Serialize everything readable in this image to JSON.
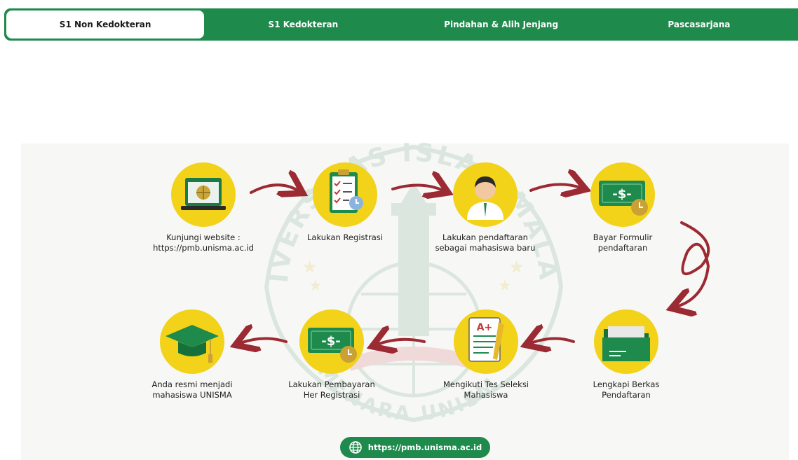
{
  "tabs": [
    {
      "label": "S1 Non Kedokteran",
      "active": true
    },
    {
      "label": "S1 Kedokteran",
      "active": false
    },
    {
      "label": "Pindahan & Alih Jenjang",
      "active": false
    },
    {
      "label": "Pascasarjana",
      "active": false
    }
  ],
  "watermark": {
    "text": "UNIVERSITAS ISLAM MALANG",
    "motto": "MENARA UNISMA"
  },
  "steps": [
    {
      "label": "Kunjungi website :\nhttps://pmb.unisma.ac.id",
      "icon": "globe-laptop-icon"
    },
    {
      "label": "Lakukan Registrasi",
      "icon": "clipboard-checklist-icon"
    },
    {
      "label": "Lakukan pendaftaran\nsebagai mahasiswa baru",
      "icon": "student-avatar-icon"
    },
    {
      "label": "Bayar Formulir\npendaftaran",
      "icon": "money-bill-clock-icon"
    },
    {
      "label": "Lengkapi Berkas\nPendaftaran",
      "icon": "folder-icon"
    },
    {
      "label": "Mengikuti Tes Seleksi\nMahasiswa",
      "icon": "exam-paper-icon"
    },
    {
      "label": "Lakukan Pembayaran\nHer Registrasi",
      "icon": "money-bill-clock-icon"
    },
    {
      "label": "Anda resmi menjadi\nmahasiswa UNISMA",
      "icon": "graduation-cap-icon"
    }
  ],
  "url_button": {
    "label": "https://pmb.unisma.ac.id",
    "icon": "globe-icon"
  },
  "colors": {
    "brand_green": "#1e8a4c",
    "accent_yellow": "#f3d21a",
    "arrow_red": "#9b2a33",
    "panel_bg": "#f7f7f6"
  }
}
